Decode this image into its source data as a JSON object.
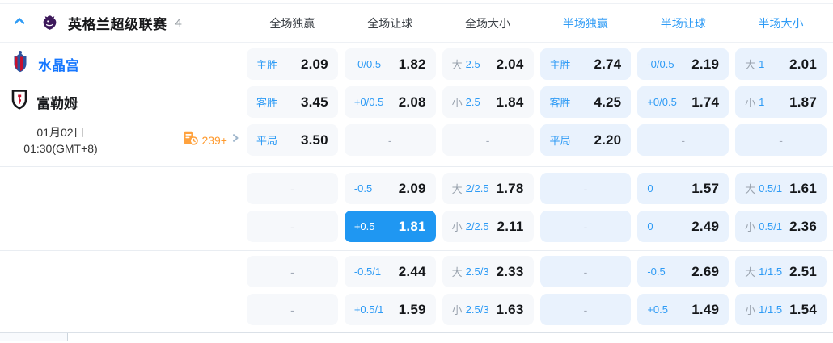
{
  "header": {
    "league_name": "英格兰超级联赛",
    "match_count": "4",
    "columns": [
      {
        "label": "全场独赢",
        "active": false
      },
      {
        "label": "全场让球",
        "active": false
      },
      {
        "label": "全场大小",
        "active": false
      },
      {
        "label": "半场独赢",
        "active": true
      },
      {
        "label": "半场让球",
        "active": true
      },
      {
        "label": "半场大小",
        "active": true
      }
    ]
  },
  "match": {
    "home_team": "水晶宫",
    "away_team": "富勒姆",
    "date": "01月02日",
    "time": "01:30(GMT+8)",
    "markets_count": "239+"
  },
  "icons": {
    "collapse": "chevron-up-icon",
    "league": "premier-league-lion-logo",
    "home_crest": "crystal-palace-crest",
    "away_crest": "fulham-crest",
    "markets": "markets-list-clock-icon",
    "more": "chevron-right-icon"
  },
  "colors": {
    "accent_blue": "#2e9bf5",
    "selected_cell_bg": "#1f97f2",
    "fulltime_cell_bg": "#f6f8fb",
    "halftime_cell_bg": "#e9f2fd",
    "home_team_blue": "#1677ff",
    "markets_orange": "#ff9a2e",
    "pl_purple": "#3d195b"
  },
  "odds_groups": [
    {
      "rows": [
        [
          {
            "hc": "主胜",
            "odds": "2.09"
          },
          {
            "hc": "-0/0.5",
            "odds": "1.82"
          },
          {
            "pre": "大",
            "hc": "2.5",
            "odds": "2.04"
          },
          {
            "hc": "主胜",
            "odds": "2.74"
          },
          {
            "hc": "-0/0.5",
            "odds": "2.19"
          },
          {
            "pre": "大",
            "hc": "1",
            "odds": "2.01"
          }
        ],
        [
          {
            "hc": "客胜",
            "odds": "3.45"
          },
          {
            "hc": "+0/0.5",
            "odds": "2.08"
          },
          {
            "pre": "小",
            "hc": "2.5",
            "odds": "1.84"
          },
          {
            "hc": "客胜",
            "odds": "4.25"
          },
          {
            "hc": "+0/0.5",
            "odds": "1.74"
          },
          {
            "pre": "小",
            "hc": "1",
            "odds": "1.87"
          }
        ],
        [
          {
            "hc": "平局",
            "odds": "3.50"
          },
          {
            "empty": true,
            "odds": "-"
          },
          {
            "empty": true,
            "odds": "-"
          },
          {
            "hc": "平局",
            "odds": "2.20"
          },
          {
            "empty": true,
            "odds": "-"
          },
          {
            "empty": true,
            "odds": "-"
          }
        ]
      ]
    },
    {
      "rows": [
        [
          {
            "empty": true,
            "odds": "-"
          },
          {
            "hc": "-0.5",
            "odds": "2.09"
          },
          {
            "pre": "大",
            "hc": "2/2.5",
            "odds": "1.78"
          },
          {
            "empty": true,
            "odds": "-"
          },
          {
            "hc": "0",
            "odds": "1.57"
          },
          {
            "pre": "大",
            "hc": "0.5/1",
            "odds": "1.61"
          }
        ],
        [
          {
            "empty": true,
            "odds": "-"
          },
          {
            "hc": "+0.5",
            "odds": "1.81",
            "selected": true
          },
          {
            "pre": "小",
            "hc": "2/2.5",
            "odds": "2.11"
          },
          {
            "empty": true,
            "odds": "-"
          },
          {
            "hc": "0",
            "odds": "2.49"
          },
          {
            "pre": "小",
            "hc": "0.5/1",
            "odds": "2.36"
          }
        ]
      ]
    },
    {
      "rows": [
        [
          {
            "empty": true,
            "odds": "-"
          },
          {
            "hc": "-0.5/1",
            "odds": "2.44"
          },
          {
            "pre": "大",
            "hc": "2.5/3",
            "odds": "2.33"
          },
          {
            "empty": true,
            "odds": "-"
          },
          {
            "hc": "-0.5",
            "odds": "2.69"
          },
          {
            "pre": "大",
            "hc": "1/1.5",
            "odds": "2.51"
          }
        ],
        [
          {
            "empty": true,
            "odds": "-"
          },
          {
            "hc": "+0.5/1",
            "odds": "1.59"
          },
          {
            "pre": "小",
            "hc": "2.5/3",
            "odds": "1.63"
          },
          {
            "empty": true,
            "odds": "-"
          },
          {
            "hc": "+0.5",
            "odds": "1.49"
          },
          {
            "pre": "小",
            "hc": "1/1.5",
            "odds": "1.54"
          }
        ]
      ]
    }
  ]
}
